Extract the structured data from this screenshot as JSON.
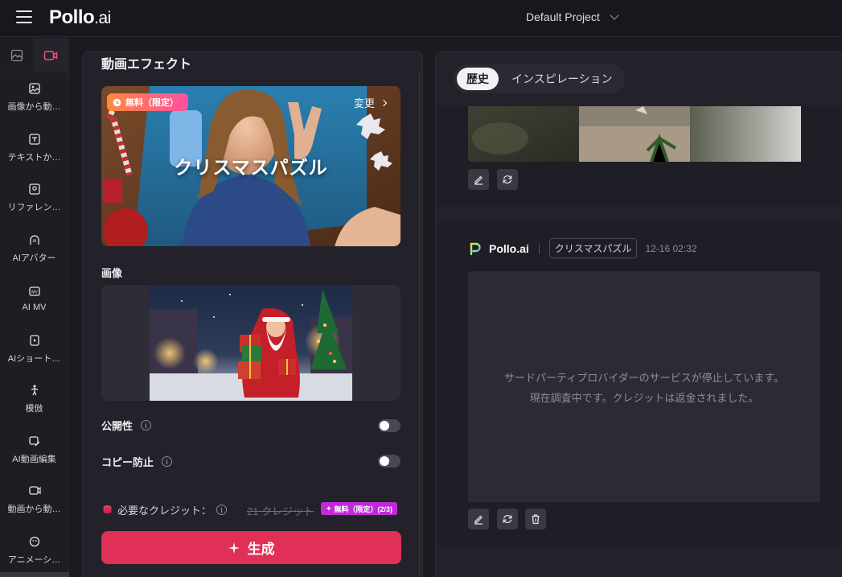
{
  "app": {
    "logo_main": "Pollo",
    "logo_suffix": ".ai",
    "project": "Default Project"
  },
  "sidebar": {
    "items": [
      {
        "label": "画像から動…",
        "icon": "image-to-video-icon"
      },
      {
        "label": "テキストか…",
        "icon": "text-to-video-icon"
      },
      {
        "label": "リファレン…",
        "icon": "reference-icon"
      },
      {
        "label": "AIアバター",
        "icon": "avatar-icon"
      },
      {
        "label": "AI MV",
        "icon": "music-video-icon"
      },
      {
        "label": "AIショート…",
        "icon": "shorts-icon"
      },
      {
        "label": "模倣",
        "icon": "mimic-icon"
      },
      {
        "label": "AI動画編集",
        "icon": "video-edit-icon"
      },
      {
        "label": "動画から動…",
        "icon": "video-to-video-icon"
      },
      {
        "label": "アニメーシ…",
        "icon": "animation-icon"
      }
    ]
  },
  "left": {
    "title": "動画エフェクト",
    "effect": {
      "badge": "無料（限定）",
      "change": "変更",
      "name": "クリスマスパズル"
    },
    "image_label": "画像",
    "public_label": "公開性",
    "copy_protect_label": "コピー防止",
    "credits_label": "必要なクレジット：",
    "credits_old": "21 クレジット",
    "credits_badge": "無料（限定）(2/3)",
    "generate": "生成"
  },
  "right": {
    "tabs": [
      "歴史",
      "インスピレーション"
    ],
    "card2": {
      "brand": "Pollo.ai",
      "tag": "クリスマスパズル",
      "time": "12-16 02:32",
      "error_line1": "サードパーティプロバイダーのサービスが停止しています。",
      "error_line2": "現在調査中です。クレジットは返金されました。"
    }
  },
  "colors": {
    "accent": "#e03058",
    "badge_gradient_start": "#ff8a3c",
    "badge_gradient_end": "#ff4fa2",
    "credits_badge": "#c02ad8"
  }
}
